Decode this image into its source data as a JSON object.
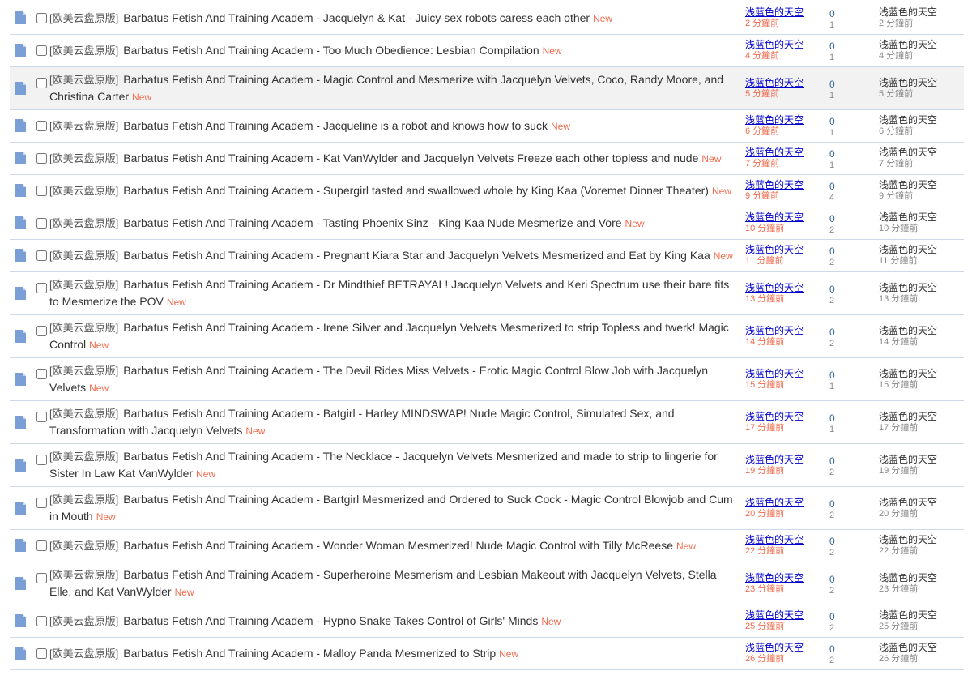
{
  "tag": "[欧美云盘原版]",
  "new_label": "New",
  "threads": [
    {
      "title": "Barbatus Fetish And Training Academ - Jacquelyn & Kat - Juicy sex robots caress each other",
      "author": "浅蓝色的天空",
      "post_time": "2 分鐘前",
      "replies": "0",
      "views": "1",
      "last_poster": "浅蓝色的天空",
      "last_time": "2 分鐘前"
    },
    {
      "title": "Barbatus Fetish And Training Academ - Too Much Obedience: Lesbian Compilation",
      "author": "浅蓝色的天空",
      "post_time": "4 分鐘前",
      "replies": "0",
      "views": "1",
      "last_poster": "浅蓝色的天空",
      "last_time": "4 分鐘前"
    },
    {
      "title": "Barbatus Fetish And Training Academ - Magic Control and Mesmerize with Jacquelyn Velvets, Coco, Randy Moore, and Christina Carter",
      "author": "浅蓝色的天空",
      "post_time": "5 分鐘前",
      "replies": "0",
      "views": "1",
      "last_poster": "浅蓝色的天空",
      "last_time": "5 分鐘前"
    },
    {
      "title": "Barbatus Fetish And Training Academ - Jacqueline is a robot and knows how to suck",
      "author": "浅蓝色的天空",
      "post_time": "6 分鐘前",
      "replies": "0",
      "views": "1",
      "last_poster": "浅蓝色的天空",
      "last_time": "6 分鐘前"
    },
    {
      "title": "Barbatus Fetish And Training Academ - Kat VanWylder and Jacquelyn Velvets Freeze each other topless and nude",
      "author": "浅蓝色的天空",
      "post_time": "7 分鐘前",
      "replies": "0",
      "views": "1",
      "last_poster": "浅蓝色的天空",
      "last_time": "7 分鐘前"
    },
    {
      "title": "Barbatus Fetish And Training Academ - Supergirl tasted and swallowed whole by King Kaa (Voremet Dinner Theater)",
      "author": "浅蓝色的天空",
      "post_time": "9 分鐘前",
      "replies": "0",
      "views": "4",
      "last_poster": "浅蓝色的天空",
      "last_time": "9 分鐘前"
    },
    {
      "title": "Barbatus Fetish And Training Academ - Tasting Phoenix Sinz - King Kaa Nude Mesmerize and Vore",
      "author": "浅蓝色的天空",
      "post_time": "10 分鐘前",
      "replies": "0",
      "views": "2",
      "last_poster": "浅蓝色的天空",
      "last_time": "10 分鐘前"
    },
    {
      "title": "Barbatus Fetish And Training Academ - Pregnant Kiara Star and Jacquelyn Velvets Mesmerized and Eat by King Kaa",
      "author": "浅蓝色的天空",
      "post_time": "11 分鐘前",
      "replies": "0",
      "views": "2",
      "last_poster": "浅蓝色的天空",
      "last_time": "11 分鐘前"
    },
    {
      "title": "Barbatus Fetish And Training Academ - Dr Mindthief BETRAYAL! Jacquelyn Velvets and Keri Spectrum use their bare tits to Mesmerize the POV",
      "author": "浅蓝色的天空",
      "post_time": "13 分鐘前",
      "replies": "0",
      "views": "2",
      "last_poster": "浅蓝色的天空",
      "last_time": "13 分鐘前"
    },
    {
      "title": "Barbatus Fetish And Training Academ - Irene Silver and Jacquelyn Velvets Mesmerized to strip Topless and twerk! Magic Control",
      "author": "浅蓝色的天空",
      "post_time": "14 分鐘前",
      "replies": "0",
      "views": "2",
      "last_poster": "浅蓝色的天空",
      "last_time": "14 分鐘前"
    },
    {
      "title": "Barbatus Fetish And Training Academ - The Devil Rides Miss Velvets - Erotic Magic Control Blow Job with Jacquelyn Velvets",
      "author": "浅蓝色的天空",
      "post_time": "15 分鐘前",
      "replies": "0",
      "views": "1",
      "last_poster": "浅蓝色的天空",
      "last_time": "15 分鐘前"
    },
    {
      "title": "Barbatus Fetish And Training Academ - Batgirl - Harley MINDSWAP! Nude Magic Control, Simulated Sex, and Transformation with Jacquelyn Velvets",
      "author": "浅蓝色的天空",
      "post_time": "17 分鐘前",
      "replies": "0",
      "views": "1",
      "last_poster": "浅蓝色的天空",
      "last_time": "17 分鐘前"
    },
    {
      "title": "Barbatus Fetish And Training Academ - The Necklace - Jacquelyn Velvets Mesmerized and made to strip to lingerie for Sister In Law Kat VanWylder",
      "author": "浅蓝色的天空",
      "post_time": "19 分鐘前",
      "replies": "0",
      "views": "2",
      "last_poster": "浅蓝色的天空",
      "last_time": "19 分鐘前"
    },
    {
      "title": "Barbatus Fetish And Training Academ - Bartgirl Mesmerized and Ordered to Suck Cock - Magic Control Blowjob and Cum in Mouth",
      "author": "浅蓝色的天空",
      "post_time": "20 分鐘前",
      "replies": "0",
      "views": "2",
      "last_poster": "浅蓝色的天空",
      "last_time": "20 分鐘前"
    },
    {
      "title": "Barbatus Fetish And Training Academ - Wonder Woman Mesmerized! Nude Magic Control with Tilly McReese",
      "author": "浅蓝色的天空",
      "post_time": "22 分鐘前",
      "replies": "0",
      "views": "2",
      "last_poster": "浅蓝色的天空",
      "last_time": "22 分鐘前"
    },
    {
      "title": "Barbatus Fetish And Training Academ - Superheroine Mesmerism and Lesbian Makeout with Jacquelyn Velvets, Stella Elle, and Kat VanWylder",
      "author": "浅蓝色的天空",
      "post_time": "23 分鐘前",
      "replies": "0",
      "views": "2",
      "last_poster": "浅蓝色的天空",
      "last_time": "23 分鐘前"
    },
    {
      "title": "Barbatus Fetish And Training Academ - Hypno Snake Takes Control of Girls' Minds",
      "author": "浅蓝色的天空",
      "post_time": "25 分鐘前",
      "replies": "0",
      "views": "2",
      "last_poster": "浅蓝色的天空",
      "last_time": "25 分鐘前"
    },
    {
      "title": "Barbatus Fetish And Training Academ - Malloy Panda Mesmerized to Strip",
      "author": "浅蓝色的天空",
      "post_time": "26 分鐘前",
      "replies": "0",
      "views": "2",
      "last_poster": "浅蓝色的天空",
      "last_time": "26 分鐘前"
    }
  ]
}
